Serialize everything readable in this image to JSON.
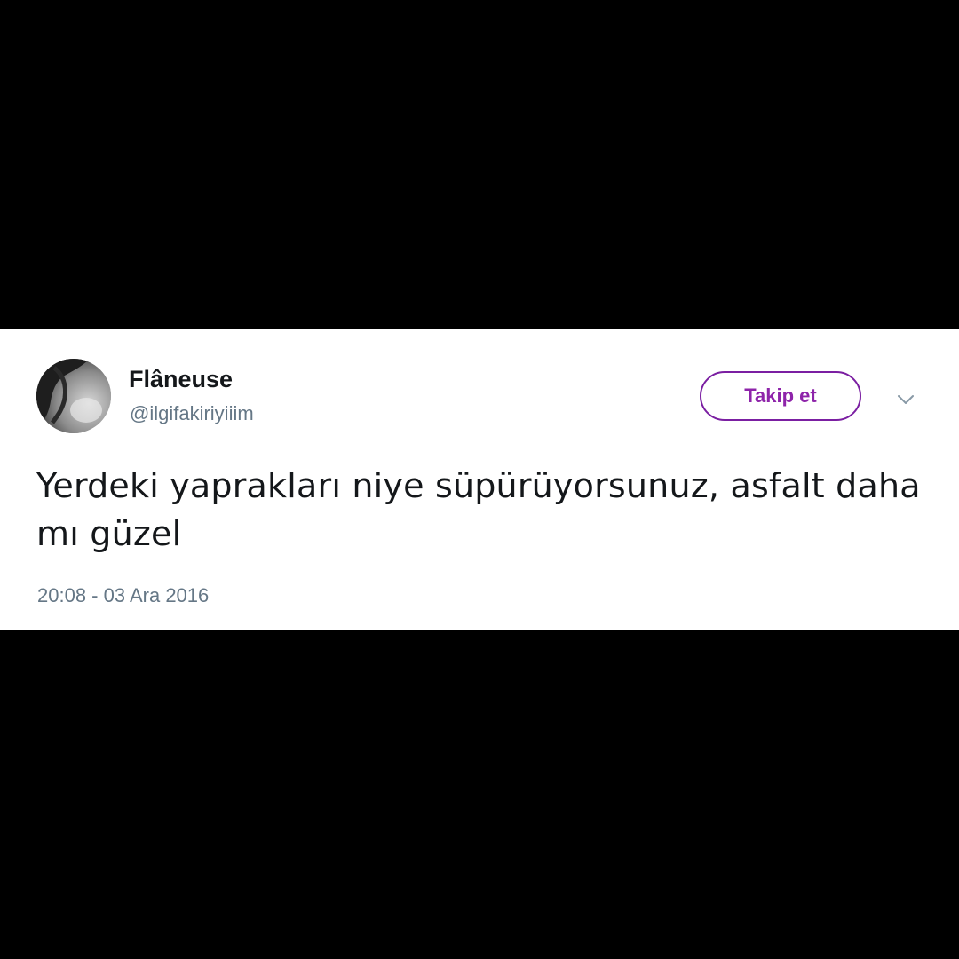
{
  "tweet": {
    "author": {
      "display_name": "Flâneuse",
      "handle": "@ilgifakiriyiiim",
      "avatar_icon": "profile-photo"
    },
    "follow_button_label": "Takip et",
    "menu_icon": "chevron-down-icon",
    "text": "Yerdeki yaprakları niye süpürüyorsunuz, asfalt daha mı güzel",
    "timestamp": "20:08 - 03 Ara 2016"
  },
  "colors": {
    "background": "#000000",
    "card": "#ffffff",
    "accent": "#8e24aa",
    "secondary_text": "#657786",
    "primary_text": "#14171a"
  }
}
